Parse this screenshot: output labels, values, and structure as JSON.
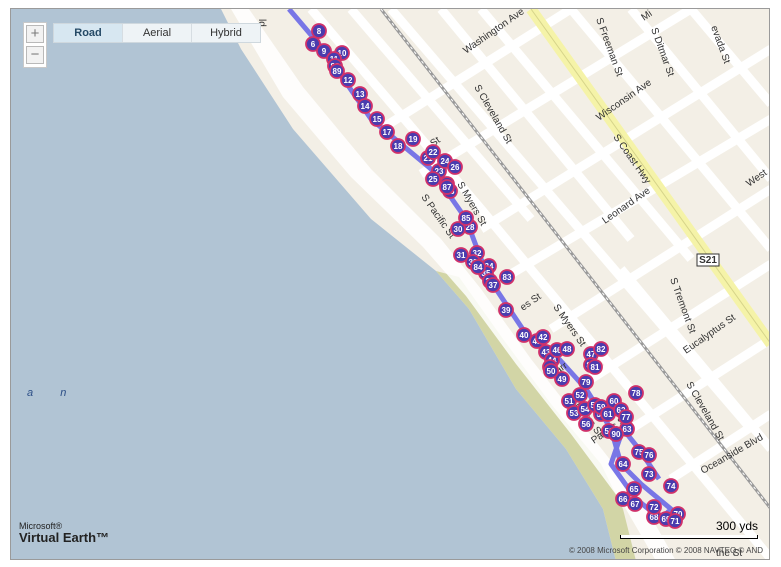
{
  "map": {
    "type": "road",
    "provider": "Microsoft Virtual Earth",
    "zoom_in_symbol": "+",
    "zoom_out_symbol": "−",
    "map_modes": [
      {
        "label": "Road",
        "active": true
      },
      {
        "label": "Aerial",
        "active": false
      },
      {
        "label": "Hybrid",
        "active": false
      }
    ],
    "streets": [
      "ld",
      "Washington Ave",
      "S Freeman St",
      "S Ditmar St",
      "Mi",
      "evada St",
      "S Cleveland St",
      "Wisconsin Ave",
      "S Coast Hwy",
      "Leonard Ave",
      "West",
      "St",
      "S Myers St",
      "S Pacific St",
      "S Tremont St",
      "Eucalyptus St",
      "S Cleveland St",
      "Oceanside Blvd",
      "es St",
      "S Myers St",
      "Pacific St",
      "arr",
      "S Myers St",
      "the St"
    ],
    "route_badge": "S21",
    "sea_labels": [
      "a",
      "n"
    ],
    "route_colors": {
      "line": "#6a68e6",
      "marker_fill": "#4a3cae",
      "marker_ring": "#d0316a"
    },
    "water_color": "#b1c4d4",
    "beach_color": "#d2d5a6",
    "land_color": "#f3efe6",
    "markers": [
      "6",
      "8",
      "9",
      "10",
      "11",
      "12",
      "13",
      "14",
      "15",
      "17",
      "18",
      "19",
      "21",
      "22",
      "23",
      "24",
      "25",
      "26",
      "27",
      "28",
      "30",
      "31",
      "32",
      "33",
      "34",
      "35",
      "36",
      "37",
      "39",
      "40",
      "41",
      "42",
      "43",
      "44",
      "45",
      "46",
      "47",
      "48",
      "49",
      "50",
      "51",
      "52",
      "53",
      "54",
      "55",
      "56",
      "57",
      "58",
      "59",
      "60",
      "61",
      "62",
      "63",
      "64",
      "65",
      "66",
      "67",
      "68",
      "69",
      "70",
      "71",
      "72",
      "73",
      "74",
      "75",
      "76",
      "77",
      "78",
      "79",
      "80",
      "81",
      "82",
      "83",
      "84",
      "85",
      "86",
      "87",
      "88",
      "89",
      "90"
    ]
  },
  "brand": {
    "line1": "Microsoft®",
    "line2": "Virtual Earth™"
  },
  "scale": {
    "label": "300 yds"
  },
  "copyright": "© 2008 Microsoft Corporation   © 2008 NAVTEQ   © AND"
}
